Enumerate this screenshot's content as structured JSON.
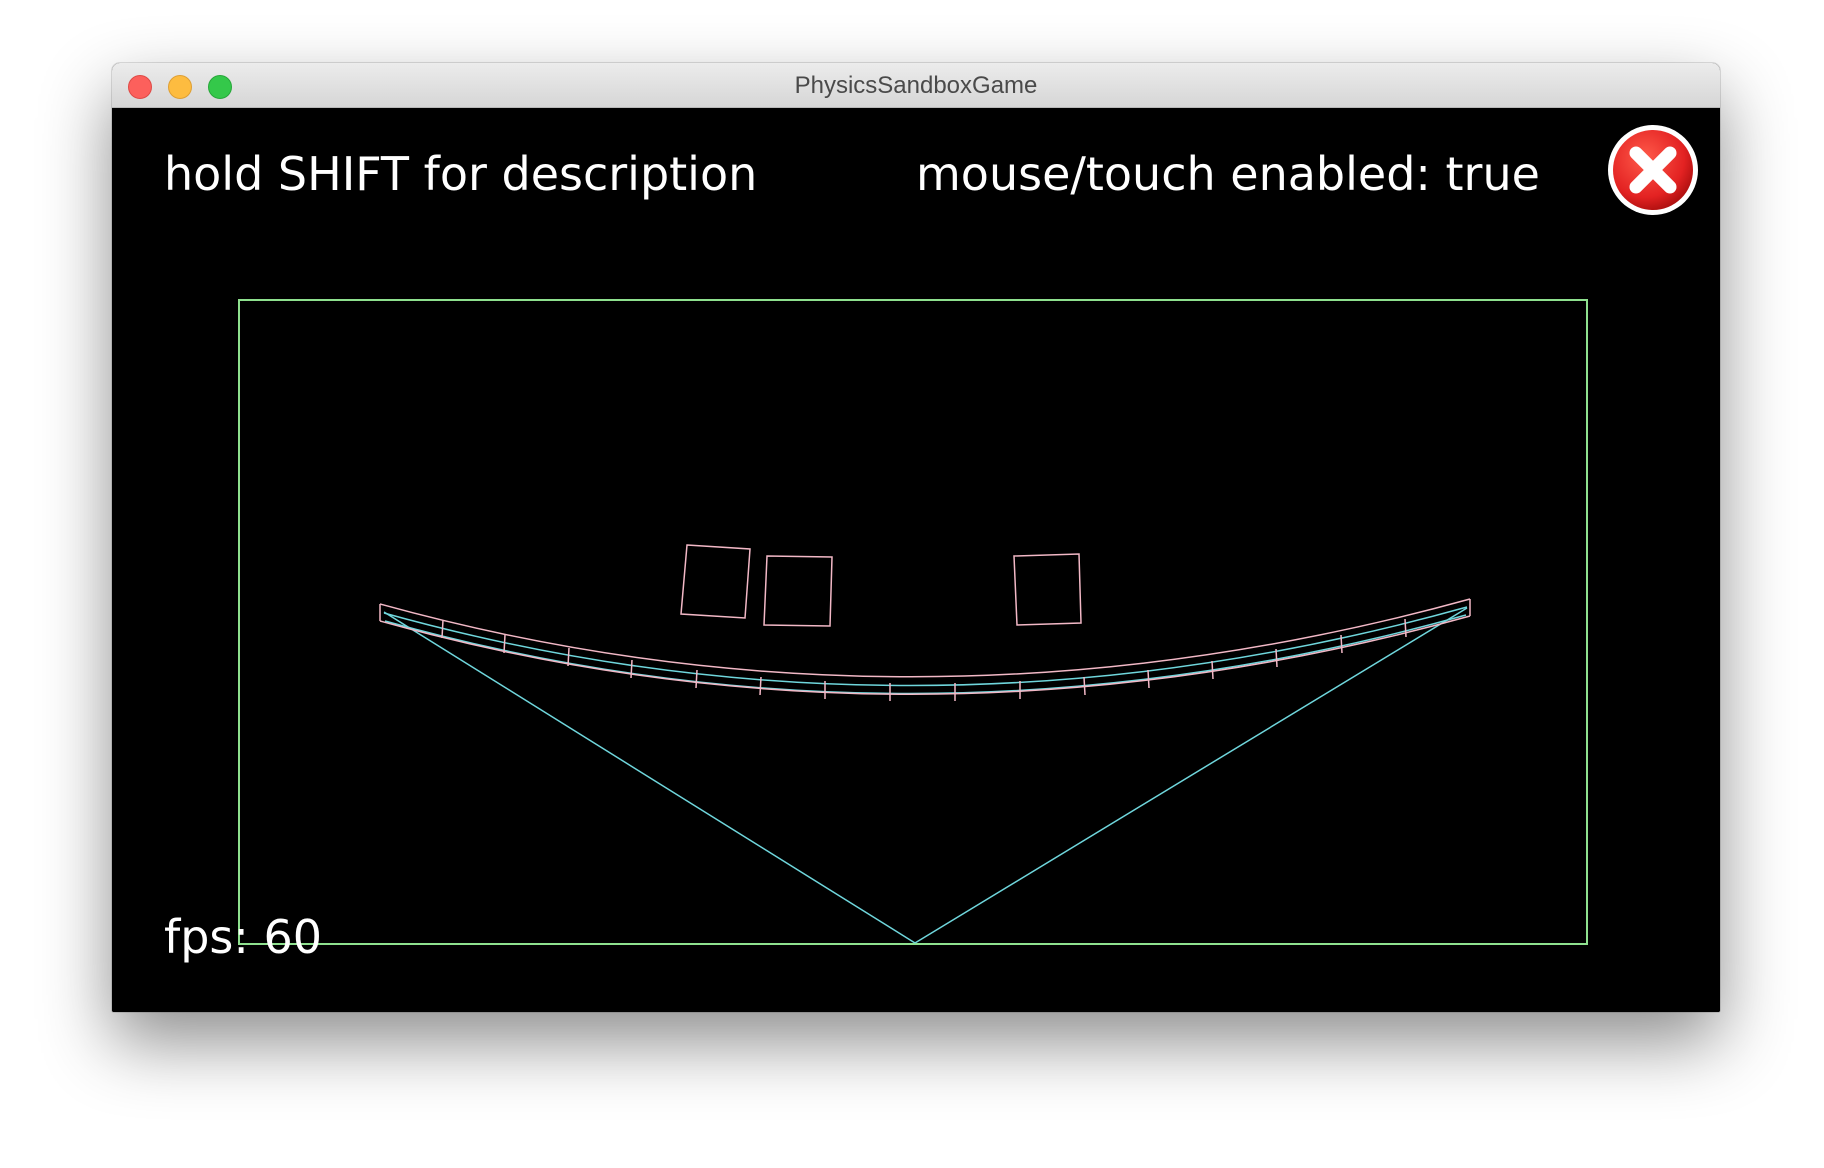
{
  "window": {
    "title": "PhysicsSandboxGame"
  },
  "hud": {
    "hint": "hold SHIFT for description",
    "mouse_status": "mouse/touch enabled: true",
    "fps": "fps: 60"
  },
  "icons": {
    "close": "close-icon",
    "traffic_close": "window-close-icon",
    "traffic_minimize": "window-minimize-icon",
    "traffic_maximize": "window-maximize-icon"
  },
  "colors": {
    "background": "#000000",
    "boundary": "#8ee08e",
    "bridge_outline": "#f2b8c6",
    "cable": "#6fd6dc",
    "text": "#ffffff",
    "close_button": "#e32222"
  }
}
